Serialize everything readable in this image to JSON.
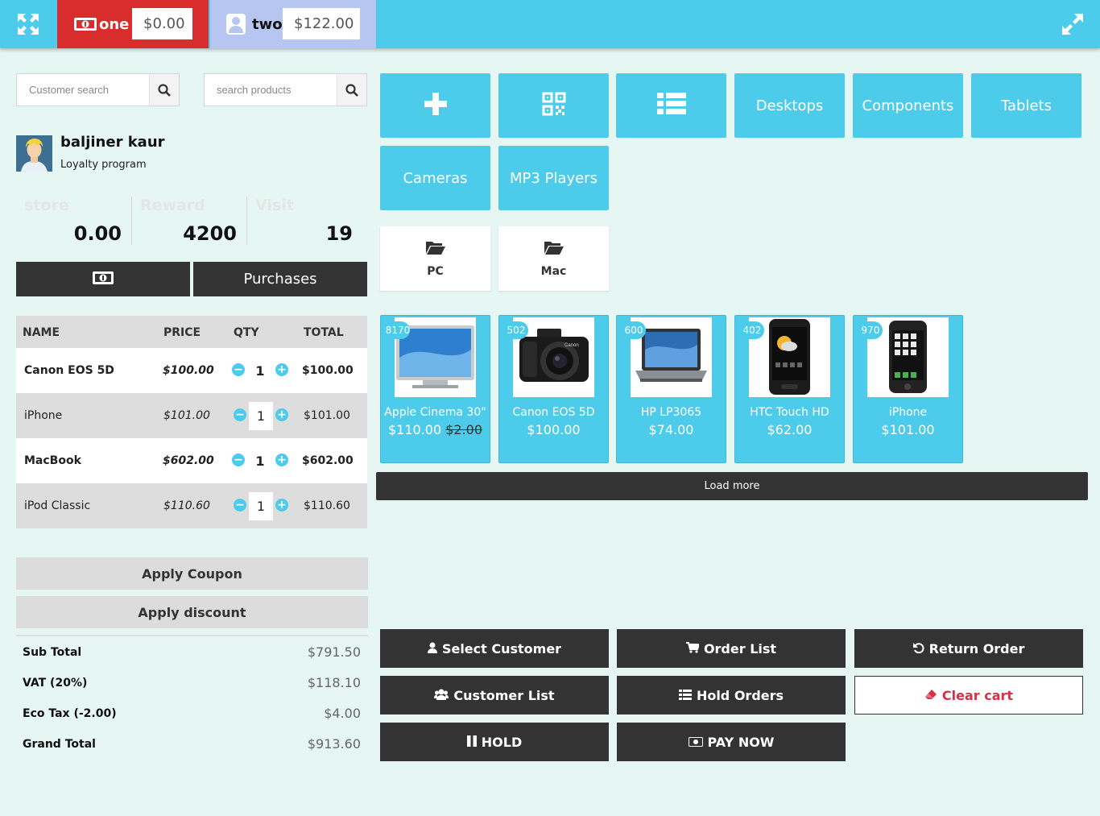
{
  "registers": [
    {
      "name": "one",
      "amount": "$0.00",
      "color": "#d92d2d",
      "icon": "money-icon"
    },
    {
      "name": "two",
      "amount": "$122.00",
      "color": "#b7c6f0",
      "icon": "user-icon"
    }
  ],
  "search": {
    "customer_placeholder": "Customer search",
    "product_placeholder": "search products"
  },
  "customer": {
    "name": "baljiner kaur",
    "program": "Loyalty program",
    "stats": [
      {
        "label": "store",
        "value": "0.00"
      },
      {
        "label": "Reward",
        "value": "4200"
      },
      {
        "label": "Visit",
        "value": "19"
      }
    ]
  },
  "purchases_label": "Purchases",
  "cart": {
    "headers": {
      "name": "NAME",
      "price": "PRICE",
      "qty": "QTY",
      "total": "TOTAL"
    },
    "items": [
      {
        "name": "Canon EOS 5D",
        "price": "$100.00",
        "qty": "1",
        "total": "$100.00"
      },
      {
        "name": "iPhone",
        "price": "$101.00",
        "qty": "1",
        "total": "$101.00"
      },
      {
        "name": "MacBook",
        "price": "$602.00",
        "qty": "1",
        "total": "$602.00"
      },
      {
        "name": "iPod Classic",
        "price": "$110.60",
        "qty": "1",
        "total": "$110.60"
      }
    ]
  },
  "apply_coupon": "Apply Coupon",
  "apply_discount": "Apply discount",
  "totals": [
    {
      "label": "Sub Total",
      "value": "$791.50"
    },
    {
      "label": "VAT (20%)",
      "value": "$118.10"
    },
    {
      "label": "Eco Tax (-2.00)",
      "value": "$4.00"
    },
    {
      "label": "Grand Total",
      "value": "$913.60"
    }
  ],
  "categories": [
    "Desktops",
    "Components",
    "Tablets",
    "Cameras",
    "MP3 Players"
  ],
  "subcategories": [
    "PC",
    "Mac"
  ],
  "products": [
    {
      "name": "Apple Cinema 30\"",
      "price": "$110.00",
      "old_price": "$2.00",
      "stock": "8170"
    },
    {
      "name": "Canon EOS 5D",
      "price": "$100.00",
      "stock": "502"
    },
    {
      "name": "HP LP3065",
      "price": "$74.00",
      "stock": "600"
    },
    {
      "name": "HTC Touch HD",
      "price": "$62.00",
      "stock": "402"
    },
    {
      "name": "iPhone",
      "price": "$101.00",
      "stock": "970"
    }
  ],
  "load_more": "Load more",
  "actions": {
    "select_customer": "Select Customer",
    "order_list": "Order List",
    "return_order": "Return Order",
    "customer_list": "Customer List",
    "hold_orders": "Hold Orders",
    "clear_cart": "Clear cart",
    "hold": "HOLD",
    "pay_now": "PAY NOW"
  },
  "colors": {
    "accent": "#4dcbeb",
    "dark": "#333333",
    "background": "#e6f6f2",
    "danger": "#d9304a"
  }
}
